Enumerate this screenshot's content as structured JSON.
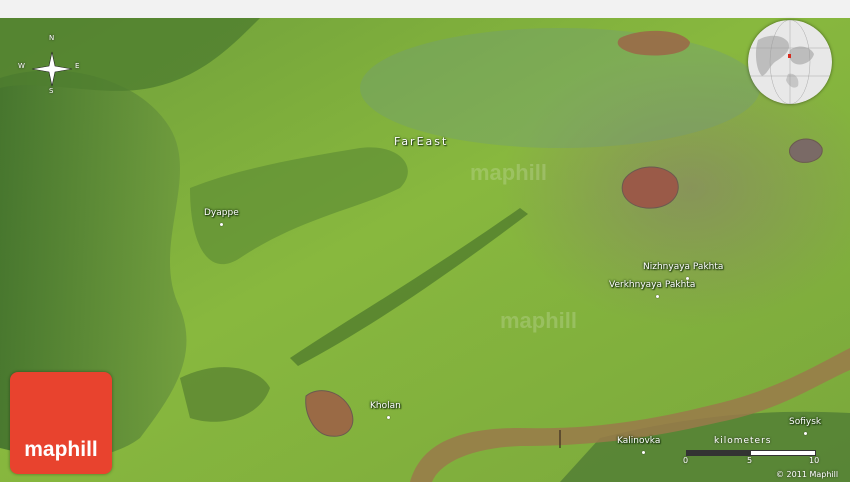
{
  "region": {
    "label": "FarEast"
  },
  "places": [
    {
      "name": "Dyappe"
    },
    {
      "name": "Nizhnyaya Pakhta"
    },
    {
      "name": "Verkhnyaya Pakhta"
    },
    {
      "name": "Kholan"
    },
    {
      "name": "Kalinovka"
    },
    {
      "name": "Sofiysk"
    }
  ],
  "compass": {
    "north": "N",
    "south": "S",
    "east": "E",
    "west": "W"
  },
  "scale": {
    "title": "kilometers",
    "ticks": [
      "0",
      "5",
      "10"
    ]
  },
  "copyright": "© 2011 Maphill",
  "logo": {
    "text": "maphill",
    "color": "#e8432e"
  },
  "watermark": "maphill",
  "colors": {
    "terrain": "#86b83a",
    "river": "#9a7a4a",
    "lake": "#9a6a45"
  }
}
